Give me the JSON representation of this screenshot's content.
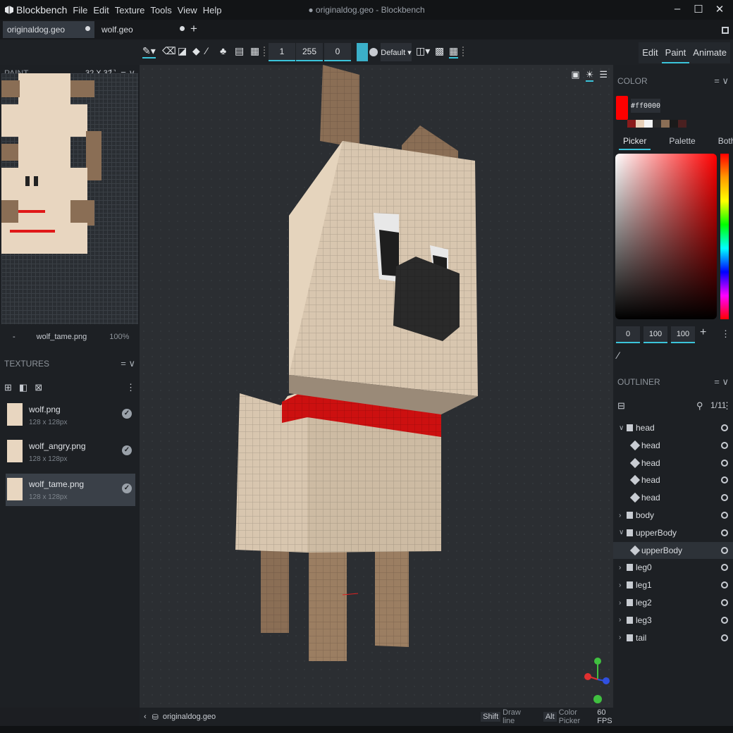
{
  "app": {
    "name": "Blockbench",
    "window_title": "● originaldog.geo - Blockbench"
  },
  "menu": [
    "File",
    "Edit",
    "Texture",
    "Tools",
    "View",
    "Help"
  ],
  "tabs": [
    {
      "label": "originaldog.geo"
    },
    {
      "label": "wolf.geo"
    }
  ],
  "toolbar": {
    "brush_size": "1",
    "opacity": "255",
    "softness": "0",
    "blend_mode": "Default ▾"
  },
  "modes": {
    "edit": "Edit",
    "paint": "Paint",
    "animate": "Animate"
  },
  "paint_panel": {
    "title": "PAINT",
    "size": "32 X 32",
    "footer_minus": "-",
    "footer_texture": "wolf_tame.png",
    "zoom": "100%"
  },
  "textures_panel": {
    "title": "TEXTURES",
    "items": [
      {
        "name": "wolf.png",
        "size": "128 x 128px"
      },
      {
        "name": "wolf_angry.png",
        "size": "128 x 128px"
      },
      {
        "name": "wolf_tame.png",
        "size": "128 x 128px"
      }
    ]
  },
  "color_panel": {
    "title": "COLOR",
    "hex": "#ff0000",
    "current_color": "#ff0000",
    "tabs": [
      "Picker",
      "Palette",
      "Both"
    ],
    "hsv": [
      "0",
      "100",
      "100"
    ],
    "recent_colors": [
      "#8b1b1b",
      "#e8d0b8",
      "#f4f4f4",
      "#2b2b2b",
      "#8a6e55",
      "#1a1a1a",
      "#4a2020"
    ]
  },
  "outliner": {
    "title": "OUTLINER",
    "count": "1/11",
    "rows": [
      {
        "label": "head",
        "kind": "group",
        "expanded": true
      },
      {
        "label": "head",
        "kind": "cube"
      },
      {
        "label": "head",
        "kind": "cube"
      },
      {
        "label": "head",
        "kind": "cube"
      },
      {
        "label": "head",
        "kind": "cube"
      },
      {
        "label": "body",
        "kind": "group",
        "expanded": false
      },
      {
        "label": "upperBody",
        "kind": "group",
        "expanded": true
      },
      {
        "label": "upperBody",
        "kind": "cube",
        "selected": true
      },
      {
        "label": "leg0",
        "kind": "group",
        "expanded": false
      },
      {
        "label": "leg1",
        "kind": "group",
        "expanded": false
      },
      {
        "label": "leg2",
        "kind": "group",
        "expanded": false
      },
      {
        "label": "leg3",
        "kind": "group",
        "expanded": false
      },
      {
        "label": "tail",
        "kind": "group",
        "expanded": false
      }
    ]
  },
  "status": {
    "file": "originaldog.geo",
    "shift_key": "Shift",
    "shift_action": "Draw line",
    "alt_key": "Alt",
    "alt_action": "Color Picker",
    "fps": "60 FPS"
  }
}
